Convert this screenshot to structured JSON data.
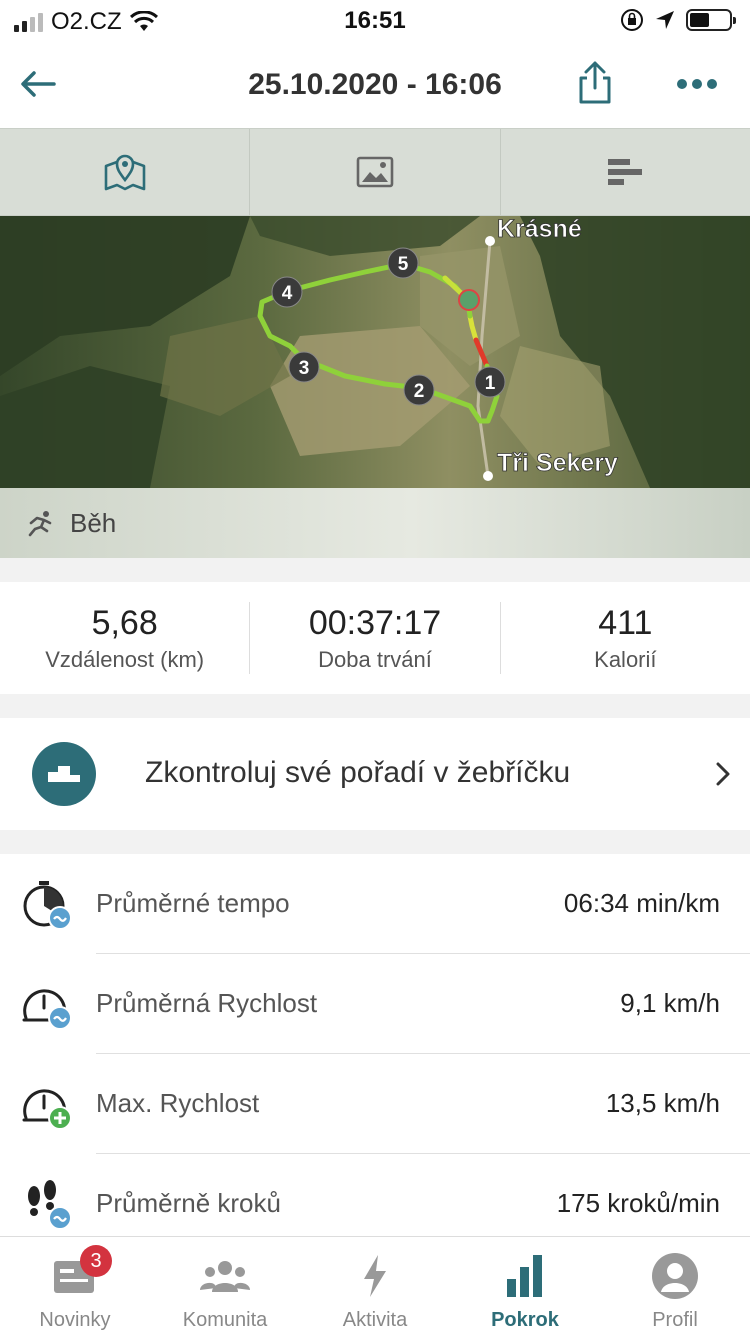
{
  "status_bar": {
    "carrier": "O2.CZ",
    "time": "16:51"
  },
  "header": {
    "title": "25.10.2020 - 16:06"
  },
  "tabs": [
    {
      "icon": "map-icon"
    },
    {
      "icon": "image-icon"
    },
    {
      "icon": "stats-bars-icon"
    }
  ],
  "map": {
    "places": [
      "Krásné",
      "Tři Sekery"
    ],
    "markers": [
      "1",
      "2",
      "3",
      "4",
      "5"
    ]
  },
  "activity": {
    "type": "Běh",
    "icon": "runner-icon"
  },
  "summary": [
    {
      "value": "5,68",
      "label": "Vzdálenost (km)"
    },
    {
      "value": "00:37:17",
      "label": "Doba trvání"
    },
    {
      "value": "411",
      "label": "Kalorií"
    }
  ],
  "leaderboard": {
    "text": "Zkontroluj své pořadí v žebříčku",
    "icon": "podium-icon"
  },
  "metrics": [
    {
      "name": "Průměrné tempo",
      "value": "06:34 min/km",
      "icon": "stopwatch-avg-icon"
    },
    {
      "name": "Průměrná Rychlost",
      "value": "9,1 km/h",
      "icon": "speedometer-avg-icon"
    },
    {
      "name": "Max. Rychlost",
      "value": "13,5 km/h",
      "icon": "speedometer-max-icon"
    },
    {
      "name": "Průměrně kroků",
      "value": "175 kroků/min",
      "icon": "footsteps-avg-icon"
    }
  ],
  "bottom_nav": [
    {
      "label": "Novinky",
      "badge": "3",
      "icon": "news-icon"
    },
    {
      "label": "Komunita",
      "icon": "community-icon"
    },
    {
      "label": "Aktivita",
      "icon": "lightning-icon"
    },
    {
      "label": "Pokrok",
      "icon": "progress-bars-icon",
      "active": true
    },
    {
      "label": "Profil",
      "icon": "profile-icon"
    }
  ],
  "colors": {
    "accent": "#2d6d78",
    "badge": "#d3333f",
    "route_green": "#8fd13a",
    "route_yellow": "#d8e23a",
    "route_red": "#e03a2a"
  }
}
